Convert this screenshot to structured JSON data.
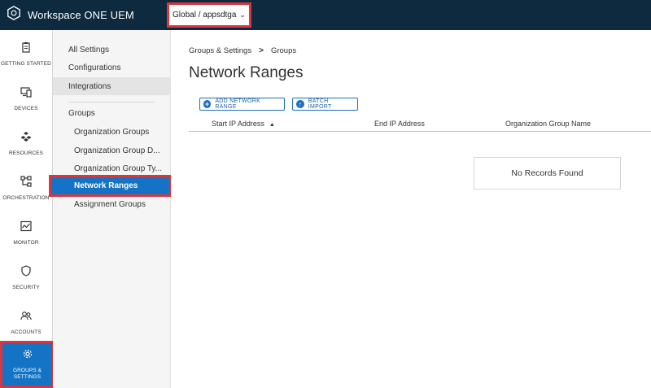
{
  "header": {
    "app_title": "Workspace ONE UEM",
    "org_group": "Global / appsdtga"
  },
  "leftnav": {
    "items": [
      {
        "label": "GETTING STARTED",
        "icon": "clipboard-icon"
      },
      {
        "label": "DEVICES",
        "icon": "devices-icon"
      },
      {
        "label": "RESOURCES",
        "icon": "resources-icon"
      },
      {
        "label": "ORCHESTRATION",
        "icon": "orchestration-icon"
      },
      {
        "label": "MONITOR",
        "icon": "monitor-icon"
      },
      {
        "label": "SECURITY",
        "icon": "shield-icon"
      },
      {
        "label": "ACCOUNTS",
        "icon": "accounts-icon"
      },
      {
        "label": "GROUPS &\nSETTINGS",
        "icon": "gear-icon",
        "active": true
      }
    ]
  },
  "settings": {
    "top_items": [
      "All Settings",
      "Configurations",
      "Integrations"
    ],
    "groups_heading": "Groups",
    "group_items": [
      "Organization Groups",
      "Organization Group D...",
      "Organization Group Ty...",
      "Network Ranges",
      "Assignment Groups"
    ]
  },
  "main": {
    "breadcrumb": {
      "parent": "Groups & Settings",
      "separator": ">",
      "current": "Groups"
    },
    "title": "Network Ranges",
    "buttons": {
      "add": "ADD NETWORK RANGE",
      "batch": "BATCH IMPORT"
    },
    "columns": [
      "Start IP Address",
      "End IP Address",
      "Organization Group Name"
    ],
    "sort_indicator": "▲",
    "empty_message": "No Records Found"
  },
  "colors": {
    "header_bg": "#0d2a3f",
    "accent": "#1473c4",
    "highlight_border": "#d9363e"
  }
}
